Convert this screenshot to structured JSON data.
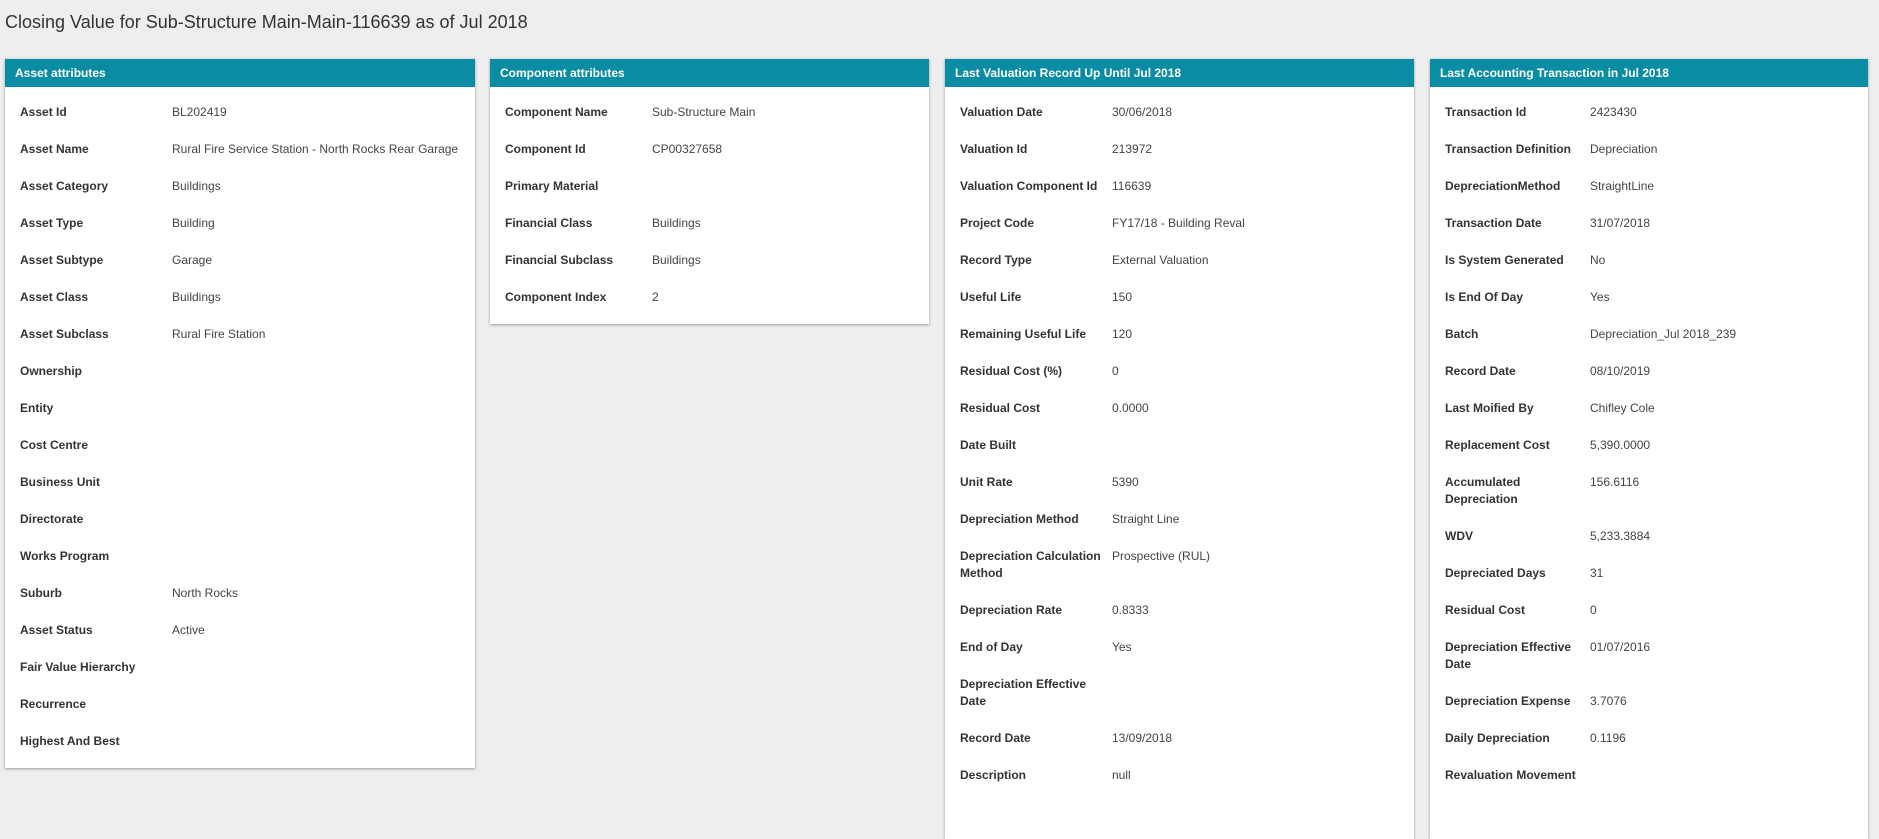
{
  "page": {
    "title": "Closing Value for Sub-Structure Main-Main-116639 as of Jul 2018"
  },
  "colors": {
    "header_bg": "#0a8ca5",
    "header_text": "#ffffff",
    "page_bg": "#eeeeee",
    "card_bg": "#ffffff"
  },
  "asset": {
    "title": "Asset attributes",
    "rows": [
      {
        "label": "Asset Id",
        "value": "BL202419"
      },
      {
        "label": "Asset Name",
        "value": "Rural Fire Service Station - North Rocks Rear Garage"
      },
      {
        "label": "Asset Category",
        "value": "Buildings"
      },
      {
        "label": "Asset Type",
        "value": "Building"
      },
      {
        "label": "Asset Subtype",
        "value": "Garage"
      },
      {
        "label": "Asset Class",
        "value": "Buildings"
      },
      {
        "label": "Asset Subclass",
        "value": "Rural Fire Station"
      },
      {
        "label": "Ownership",
        "value": ""
      },
      {
        "label": "Entity",
        "value": ""
      },
      {
        "label": "Cost Centre",
        "value": ""
      },
      {
        "label": "Business Unit",
        "value": ""
      },
      {
        "label": "Directorate",
        "value": ""
      },
      {
        "label": "Works Program",
        "value": ""
      },
      {
        "label": "Suburb",
        "value": "North Rocks"
      },
      {
        "label": "Asset Status",
        "value": "Active"
      },
      {
        "label": "Fair Value Hierarchy",
        "value": ""
      },
      {
        "label": "Recurrence",
        "value": ""
      },
      {
        "label": "Highest And Best",
        "value": ""
      }
    ]
  },
  "component": {
    "title": "Component attributes",
    "rows": [
      {
        "label": "Component Name",
        "value": "Sub-Structure Main"
      },
      {
        "label": "Component Id",
        "value": "CP00327658"
      },
      {
        "label": "Primary Material",
        "value": ""
      },
      {
        "label": "Financial Class",
        "value": "Buildings"
      },
      {
        "label": "Financial Subclass",
        "value": "Buildings"
      },
      {
        "label": "Component Index",
        "value": "2"
      }
    ]
  },
  "valuation": {
    "title": "Last Valuation Record Up Until Jul 2018",
    "rows": [
      {
        "label": "Valuation Date",
        "value": "30/06/2018"
      },
      {
        "label": "Valuation Id",
        "value": "213972"
      },
      {
        "label": "Valuation Component Id",
        "value": "116639"
      },
      {
        "label": "Project Code",
        "value": "FY17/18 - Building Reval"
      },
      {
        "label": "Record Type",
        "value": "External Valuation"
      },
      {
        "label": "Useful Life",
        "value": "150"
      },
      {
        "label": "Remaining Useful Life",
        "value": "120"
      },
      {
        "label": "Residual Cost (%)",
        "value": "0"
      },
      {
        "label": "Residual Cost",
        "value": "0.0000"
      },
      {
        "label": "Date Built",
        "value": ""
      },
      {
        "label": "Unit Rate",
        "value": "5390"
      },
      {
        "label": "Depreciation Method",
        "value": "Straight Line"
      },
      {
        "label": "Depreciation Calculation Method",
        "value": "Prospective (RUL)"
      },
      {
        "label": "Depreciation Rate",
        "value": "0.8333"
      },
      {
        "label": "End of Day",
        "value": "Yes"
      },
      {
        "label": "Depreciation Effective Date",
        "value": ""
      },
      {
        "label": "Record Date",
        "value": "13/09/2018"
      },
      {
        "label": "Description",
        "value": "null"
      }
    ]
  },
  "accounting": {
    "title": "Last Accounting Transaction in Jul 2018",
    "rows": [
      {
        "label": "Transaction Id",
        "value": "2423430"
      },
      {
        "label": "Transaction Definition",
        "value": "Depreciation"
      },
      {
        "label": "DepreciationMethod",
        "value": "StraightLine"
      },
      {
        "label": "Transaction Date",
        "value": "31/07/2018"
      },
      {
        "label": "Is System Generated",
        "value": "No"
      },
      {
        "label": "Is End Of Day",
        "value": "Yes"
      },
      {
        "label": "Batch",
        "value": "Depreciation_Jul 2018_239"
      },
      {
        "label": "Record Date",
        "value": "08/10/2019"
      },
      {
        "label": "Last Moified By",
        "value": "Chifley Cole"
      },
      {
        "label": "Replacement Cost",
        "value": "5,390.0000"
      },
      {
        "label": "Accumulated Depreciation",
        "value": "156.6116"
      },
      {
        "label": "WDV",
        "value": "5,233.3884"
      },
      {
        "label": "Depreciated Days",
        "value": "31"
      },
      {
        "label": "Residual Cost",
        "value": "0"
      },
      {
        "label": "Depreciation Effective Date",
        "value": "01/07/2016"
      },
      {
        "label": "Depreciation Expense",
        "value": "3.7076"
      },
      {
        "label": "Daily Depreciation",
        "value": "0.1196"
      },
      {
        "label": "Revaluation Movement",
        "value": ""
      }
    ]
  }
}
